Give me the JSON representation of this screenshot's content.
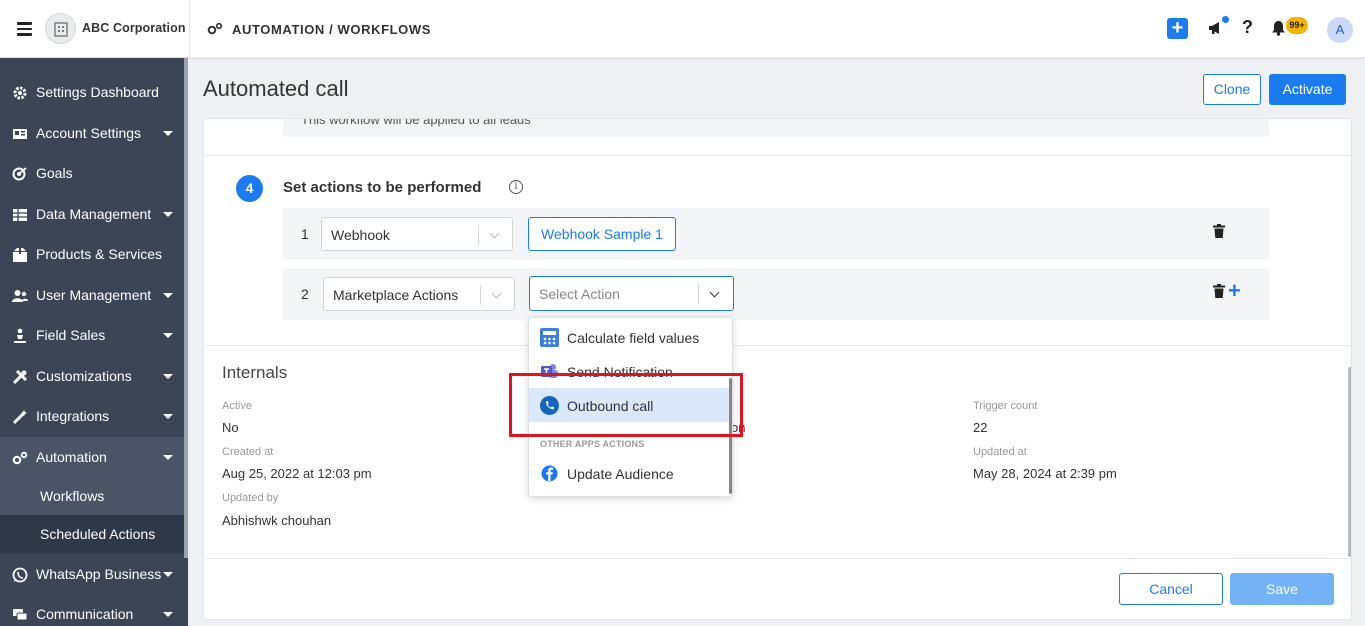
{
  "header": {
    "company": "ABC Corporation",
    "breadcrumb": "AUTOMATION / WORKFLOWS",
    "notification_badge": "99+",
    "avatar_initial": "A"
  },
  "sidebar": {
    "items": [
      {
        "label": "Settings Dashboard",
        "icon": "gear-icon"
      },
      {
        "label": "Account Settings",
        "icon": "id-card-icon"
      },
      {
        "label": "Goals",
        "icon": "target-icon"
      },
      {
        "label": "Data Management",
        "icon": "table-icon"
      },
      {
        "label": "Products & Services",
        "icon": "box-icon"
      },
      {
        "label": "User Management",
        "icon": "users-icon"
      },
      {
        "label": "Field Sales",
        "icon": "person-icon"
      },
      {
        "label": "Customizations",
        "icon": "tools-icon"
      },
      {
        "label": "Integrations",
        "icon": "magic-icon"
      },
      {
        "label": "Automation",
        "icon": "gears-icon"
      }
    ],
    "sub_items": [
      {
        "label": "Workflows"
      },
      {
        "label": "Scheduled Actions"
      }
    ],
    "more_items": [
      {
        "label": "WhatsApp Business",
        "icon": "whatsapp-icon"
      },
      {
        "label": "Communication",
        "icon": "chat-icon"
      }
    ]
  },
  "page": {
    "title": "Automated call",
    "clone_label": "Clone",
    "activate_label": "Activate",
    "partial_text": "This workflow will be applied to all leads"
  },
  "step": {
    "number": "4",
    "title": "Set actions to be performed"
  },
  "actions": [
    {
      "num": "1",
      "type": "Webhook",
      "value": "Webhook Sample 1"
    },
    {
      "num": "2",
      "type": "Marketplace Actions",
      "placeholder": "Select Action"
    }
  ],
  "dropdown": {
    "items": [
      {
        "label": "Calculate field values",
        "icon": "calculator-icon"
      },
      {
        "label": "Send Notification",
        "icon": "teams-icon"
      },
      {
        "label": "Outbound call",
        "icon": "phone-icon"
      }
    ],
    "group_label": "OTHER APPS ACTIONS",
    "group_items": [
      {
        "label": "Update Audience",
        "icon": "facebook-icon"
      }
    ]
  },
  "internals": {
    "title": "Internals",
    "active_label": "Active",
    "active_value": "No",
    "trigger_label": "Trigger count",
    "trigger_value": "22",
    "created_label": "Created at",
    "created_value": "Aug 25, 2022 at 12:03 pm",
    "updated_at_label": "Updated at",
    "updated_at_value": "May 28, 2024 at 2:39 pm",
    "updated_by_label": "Updated by",
    "updated_by_value": "Abhishwk chouhan",
    "partial_value": "on"
  },
  "footer": {
    "cancel_label": "Cancel",
    "save_label": "Save"
  },
  "colors": {
    "primary": "#1a7cf0",
    "sidebar_bg": "#3b4556",
    "highlight_box": "#e0141e"
  }
}
